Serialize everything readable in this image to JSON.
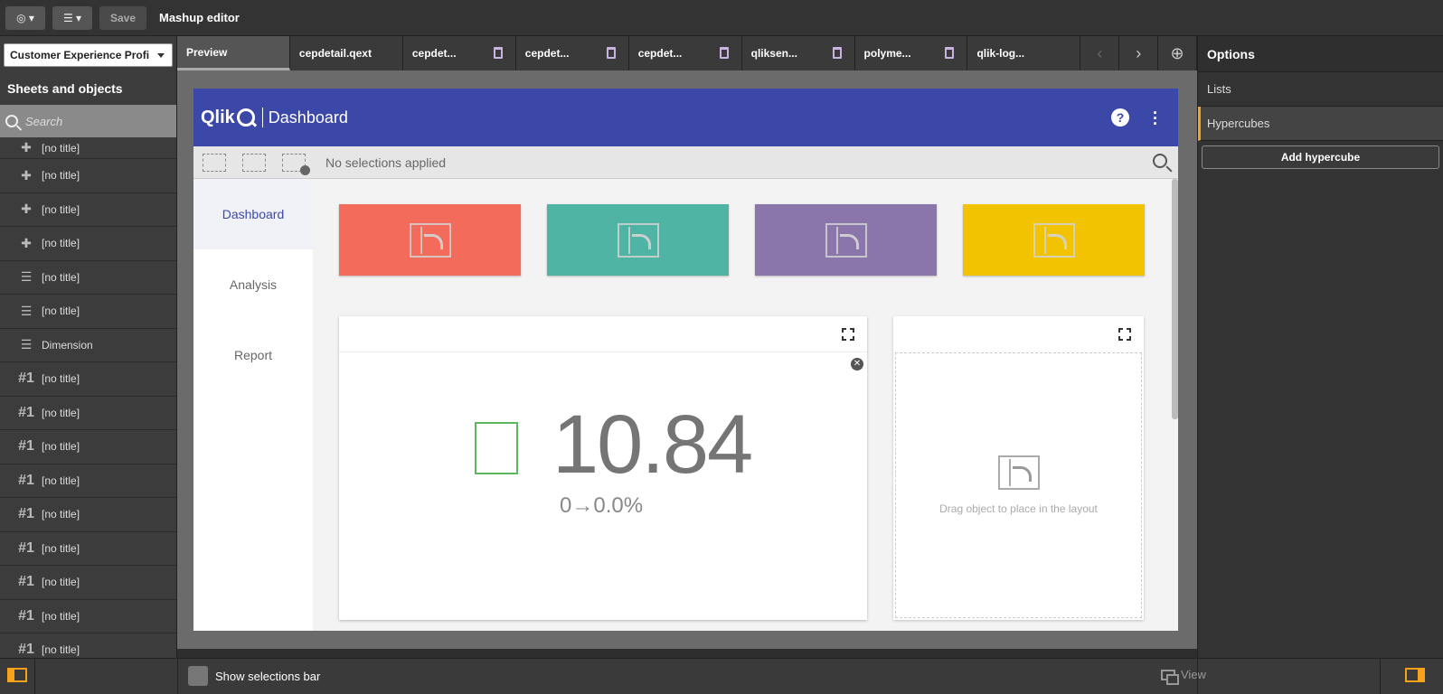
{
  "toolbar": {
    "nav_icon": "compass-icon",
    "list_icon": "list-icon",
    "save_label": "Save",
    "title": "Mashup editor"
  },
  "left_panel": {
    "app_select": "Customer Experience Profi",
    "heading": "Sheets and objects",
    "search_placeholder": "Search",
    "items": [
      {
        "icon": "puzzle-icon",
        "label": "[no title]"
      },
      {
        "icon": "puzzle-icon",
        "label": "[no title]"
      },
      {
        "icon": "puzzle-icon",
        "label": "[no title]"
      },
      {
        "icon": "puzzle-icon",
        "label": "[no title]"
      },
      {
        "icon": "list-box-icon",
        "label": "[no title]"
      },
      {
        "icon": "list-box-icon",
        "label": "[no title]"
      },
      {
        "icon": "list-box-icon",
        "label": "Dimension"
      },
      {
        "icon": "kpi-icon",
        "label": "[no title]"
      },
      {
        "icon": "kpi-icon",
        "label": "[no title]"
      },
      {
        "icon": "kpi-icon",
        "label": "[no title]"
      },
      {
        "icon": "kpi-icon",
        "label": "[no title]"
      },
      {
        "icon": "kpi-icon",
        "label": "[no title]"
      },
      {
        "icon": "kpi-icon",
        "label": "[no title]"
      },
      {
        "icon": "kpi-icon",
        "label": "[no title]"
      },
      {
        "icon": "kpi-icon",
        "label": "[no title]"
      },
      {
        "icon": "kpi-icon",
        "label": "[no title]"
      }
    ]
  },
  "tabs": [
    {
      "label": "Preview",
      "active": true,
      "deletable": false
    },
    {
      "label": "cepdetail.qext",
      "active": false,
      "deletable": false
    },
    {
      "label": "cepdet...",
      "active": false,
      "deletable": true
    },
    {
      "label": "cepdet...",
      "active": false,
      "deletable": true
    },
    {
      "label": "cepdet...",
      "active": false,
      "deletable": true
    },
    {
      "label": "qliksen...",
      "active": false,
      "deletable": true
    },
    {
      "label": "polyme...",
      "active": false,
      "deletable": true
    },
    {
      "label": "qlik-log...",
      "active": false,
      "deletable": false
    }
  ],
  "mashup": {
    "logo_text": "Qlik",
    "header_title": "Dashboard",
    "help_label": "?",
    "selections_text": "No selections applied",
    "nav": [
      {
        "label": "Dashboard",
        "active": true
      },
      {
        "label": "Analysis",
        "active": false
      },
      {
        "label": "Report",
        "active": false
      }
    ],
    "tile_colors": [
      "#f26b5b",
      "#4fb4a4",
      "#8a76aa",
      "#f2c300"
    ],
    "kpi": {
      "value": "10.84",
      "delta": "0→0.0%",
      "indicator_color": "#5cb85c"
    },
    "drop_text": "Drag object to place in the layout"
  },
  "right_panel": {
    "heading": "Options",
    "items": [
      {
        "label": "Lists",
        "active": false
      },
      {
        "label": "Hypercubes",
        "active": true
      }
    ],
    "add_button": "Add hypercube"
  },
  "bottom": {
    "show_selections_label": "Show selections bar",
    "view_label": "View",
    "accent": "#f7a21b"
  }
}
